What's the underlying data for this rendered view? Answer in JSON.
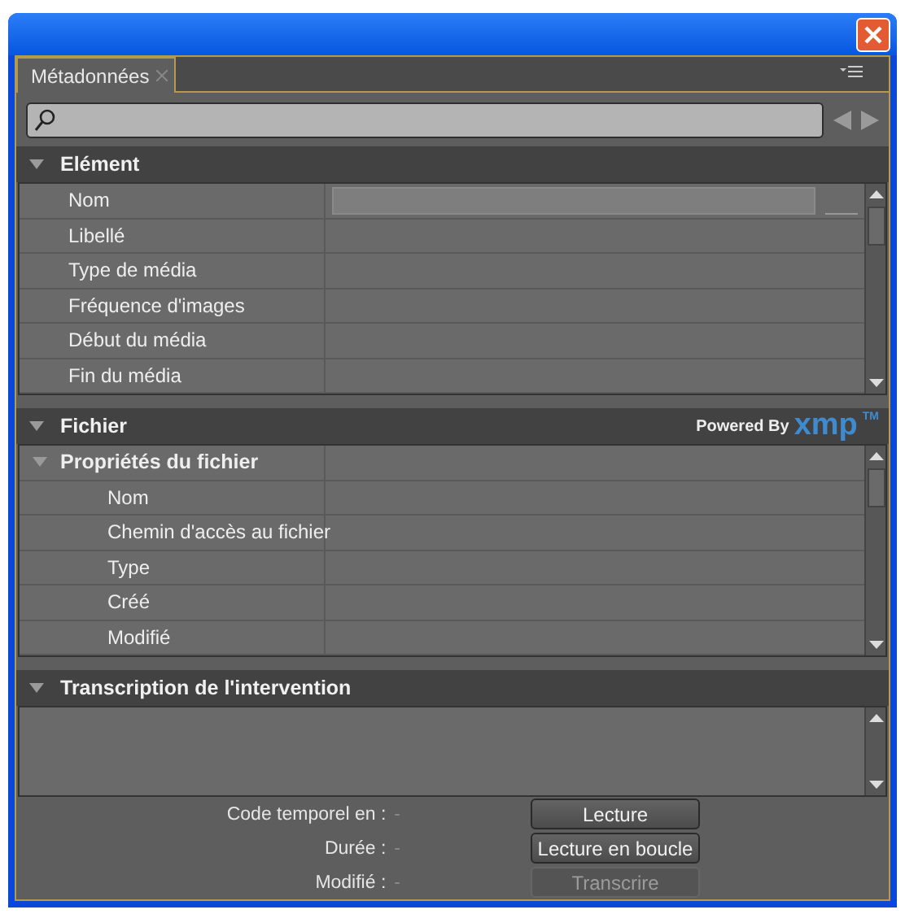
{
  "panel": {
    "tab": {
      "label": "Métadonnées",
      "selected": true
    }
  },
  "element": {
    "title": "Elément",
    "expanded": true,
    "rows": [
      {
        "label": "Nom",
        "editable": true
      },
      {
        "label": "Libellé",
        "editable": false
      },
      {
        "label": "Type de média",
        "editable": false
      },
      {
        "label": "Fréquence d'images",
        "editable": false
      },
      {
        "label": "Début du média",
        "editable": false
      },
      {
        "label": "Fin du média",
        "editable": false
      }
    ]
  },
  "fichier": {
    "title": "Fichier",
    "expanded": true,
    "powered_by": "Powered By",
    "logo": "xmp",
    "trademark": "TM",
    "group": {
      "label": "Propriétés du fichier",
      "expanded": true,
      "children": [
        {
          "label": "Nom"
        },
        {
          "label": "Chemin d'accès au fichier"
        },
        {
          "label": "Type"
        },
        {
          "label": "Créé"
        },
        {
          "label": "Modifié"
        }
      ]
    }
  },
  "transcription": {
    "title": "Transcription de l'intervention",
    "expanded": true
  },
  "info": [
    {
      "label": "Code temporel en :",
      "reading": "-"
    },
    {
      "label": "Durée :",
      "reading": "-"
    },
    {
      "label": "Modifié :",
      "reading": "-"
    }
  ],
  "buttons": [
    {
      "label": "Lecture",
      "disabled": false
    },
    {
      "label": "Lecture en boucle",
      "disabled": false
    },
    {
      "label": "Transcrire",
      "disabled": true
    }
  ]
}
